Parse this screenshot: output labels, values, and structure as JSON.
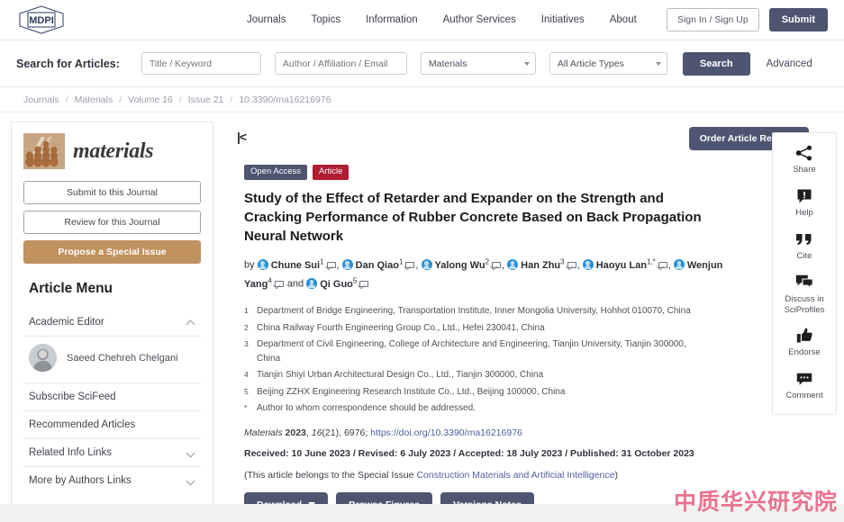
{
  "header": {
    "logo_text": "MDPI",
    "nav": [
      {
        "label": "Journals"
      },
      {
        "label": "Topics"
      },
      {
        "label": "Information"
      },
      {
        "label": "Author Services"
      },
      {
        "label": "Initiatives"
      },
      {
        "label": "About"
      }
    ],
    "sign_in": "Sign In / Sign Up",
    "submit": "Submit"
  },
  "search": {
    "label": "Search for Articles:",
    "keyword_placeholder": "Title / Keyword",
    "author_placeholder": "Author / Affiliation / Email",
    "journal_value": "Materials",
    "type_value": "All Article Types",
    "search_button": "Search",
    "advanced": "Advanced"
  },
  "breadcrumb": {
    "items": [
      "Journals",
      "Materials",
      "Volume 16",
      "Issue 21",
      "10.3390/ma16216976"
    ],
    "separator": "/"
  },
  "sidebar": {
    "journal_name": "materials",
    "submit_btn": "Submit to this Journal",
    "review_btn": "Review for this Journal",
    "propose_btn": "Propose a Special Issue",
    "menu_title": "Article Menu",
    "menu": [
      {
        "label": "Academic Editor",
        "chevron": "up",
        "name": "academic-editor"
      },
      {
        "label": "Subscribe SciFeed",
        "chevron": "none",
        "name": "subscribe-scifeed"
      },
      {
        "label": "Recommended Articles",
        "chevron": "none",
        "name": "recommended-articles"
      },
      {
        "label": "Related Info Links",
        "chevron": "down",
        "name": "related-info-links"
      },
      {
        "label": "More by Authors Links",
        "chevron": "down",
        "name": "more-by-authors-links"
      }
    ],
    "editor_name": "Saeed Chehreh Chelgani"
  },
  "article": {
    "collapse_icon": "|<",
    "reprints_button": "Order Article Reprints",
    "badge_open_access": "Open Access",
    "badge_type": "Article",
    "title": "Study of the Effect of Retarder and Expander on the Strength and Cracking Performance of Rubber Concrete Based on Back Propagation Neural Network",
    "by_label": "by",
    "and_label": "and",
    "authors": [
      {
        "name": "Chune Sui",
        "sup": "1"
      },
      {
        "name": "Dan Qiao",
        "sup": "1"
      },
      {
        "name": "Yalong Wu",
        "sup": "2"
      },
      {
        "name": "Han Zhu",
        "sup": "3"
      },
      {
        "name": "Haoyu Lan",
        "sup": "1,*"
      },
      {
        "name": "Wenjun Yang",
        "sup": "4"
      },
      {
        "name": "Qi Guo",
        "sup": "5"
      }
    ],
    "affiliations": [
      {
        "num": "1",
        "text": "Department of Bridge Engineering, Transportation Institute, Inner Mongolia University, Hohhot 010070, China"
      },
      {
        "num": "2",
        "text": "China Railway Fourth Engineering Group Co., Ltd., Hefei 230041, China"
      },
      {
        "num": "3",
        "text": "Department of Civil Engineering, College of Architecture and Engineering, Tianjin University, Tianjin 300000, China"
      },
      {
        "num": "4",
        "text": "Tianjin Shiyi Urban Architectural Design Co., Ltd., Tianjin 300000, China"
      },
      {
        "num": "5",
        "text": "Beijing ZZHX Engineering Research Institute Co., Ltd., Beijing 100000, China"
      },
      {
        "num": "*",
        "text": "Author to whom correspondence should be addressed."
      }
    ],
    "citation": {
      "journal": "Materials",
      "year": "2023",
      "volume": "16",
      "issue": "(21)",
      "article_no": "6976",
      "doi_url": "https://doi.org/10.3390/ma16216976"
    },
    "dates": "Received: 10 June 2023 / Revised: 6 July 2023 / Accepted: 18 July 2023 / Published: 31 October 2023",
    "special_issue_prefix": "(This article belongs to the Special Issue ",
    "special_issue_name": "Construction Materials and Artificial Intelligence",
    "special_issue_suffix": ")",
    "buttons": {
      "download": "Download",
      "browse_figures": "Browse Figures",
      "versions_notes": "Versions Notes"
    }
  },
  "rail": [
    {
      "label": "Share",
      "icon": "share-icon"
    },
    {
      "label": "Help",
      "icon": "help-icon"
    },
    {
      "label": "Cite",
      "icon": "quote-icon"
    },
    {
      "label": "Discuss in SciProfiles",
      "icon": "discuss-icon"
    },
    {
      "label": "Endorse",
      "icon": "thumbs-up-icon"
    },
    {
      "label": "Comment",
      "icon": "comment-icon"
    }
  ],
  "watermark": "中质华兴研究院",
  "colors": {
    "brand_slate": "#4e5571",
    "badge_red": "#b01c30",
    "gold": "#c1915f",
    "link_blue": "#4e5fa0",
    "avatar_blue": "#2d8fd5",
    "watermark_pink": "#e8738f"
  }
}
